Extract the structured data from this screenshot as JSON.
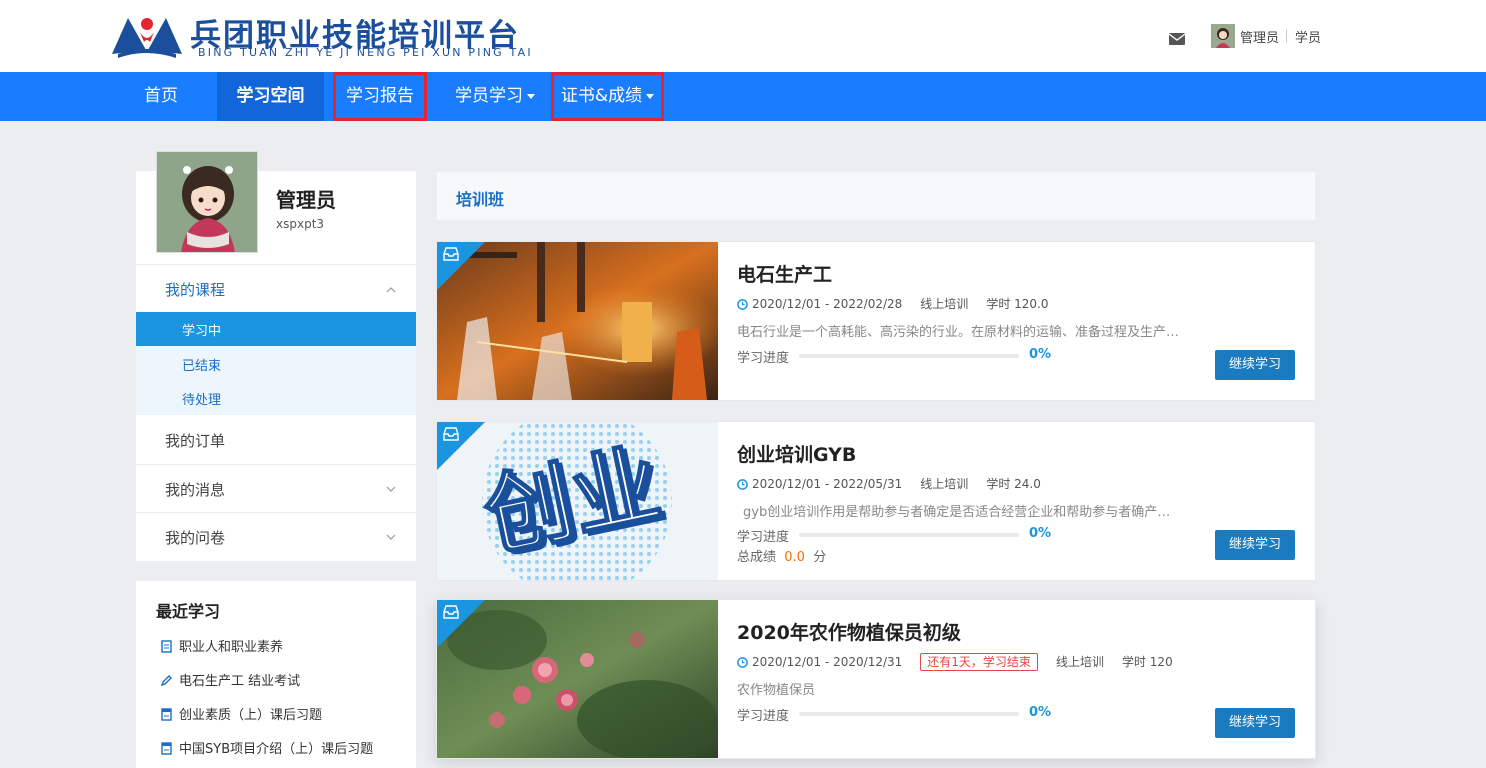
{
  "brand": {
    "title": "兵团职业技能培训平台",
    "subtitle": "BING TUAN ZHI YE JI NENG PEI XUN PING TAI"
  },
  "header": {
    "user_name": "管理员",
    "user_role": "学员"
  },
  "nav": {
    "items": [
      {
        "label": "首页"
      },
      {
        "label": "学习空间"
      },
      {
        "label": "学习报告"
      },
      {
        "label": "学员学习"
      },
      {
        "label": "证书&成绩"
      }
    ]
  },
  "profile": {
    "name": "管理员",
    "id": "xspxpt3"
  },
  "sidebar": {
    "my_courses": "我的课程",
    "sub": [
      {
        "label": "学习中"
      },
      {
        "label": "已结束"
      },
      {
        "label": "待处理"
      }
    ],
    "my_orders": "我的订单",
    "my_messages": "我的消息",
    "my_surveys": "我的问卷"
  },
  "recent": {
    "title": "最近学习",
    "items": [
      {
        "label": "职业人和职业素养",
        "icon": "document-icon"
      },
      {
        "label": "电石生产工 结业考试",
        "icon": "pencil-icon"
      },
      {
        "label": "创业素质（上）课后习题",
        "icon": "exercise-icon"
      },
      {
        "label": "中国SYB项目介绍（上）课后习题",
        "icon": "exercise-icon"
      }
    ]
  },
  "section": {
    "title": "培训班"
  },
  "courses": [
    {
      "title": "电石生产工",
      "dates": "2020/12/01 - 2022/02/28",
      "mode": "线上培训",
      "hours_label": "学时",
      "hours": "120.0",
      "desc": "电石行业是一个高耗能、高污染的行业。在原材料的运输、准备过程及生产过程中都会产生大量的粉尘和废气",
      "progress_label": "学习进度",
      "progress_text": "0%",
      "progress": 0,
      "button": "继续学习"
    },
    {
      "title": "创业培训GYB",
      "dates": "2020/12/01 - 2022/05/31",
      "mode": "线上培训",
      "hours_label": "学时",
      "hours": "24.0",
      "desc": "gyb创业培训作用是帮助参与者确定是否适合经营企业和帮助参与者确产生一个好的企业构思",
      "progress_label": "学习进度",
      "progress_text": "0%",
      "progress": 0,
      "score_label": "总成绩",
      "score": "0.0",
      "score_unit": "分",
      "thumb_text": "创业",
      "button": "继续学习"
    },
    {
      "title": "2020年农作物植保员初级",
      "dates": "2020/12/01 - 2020/12/31",
      "badge": "还有1天，学习结束",
      "mode": "线上培训",
      "hours_label": "学时",
      "hours": "120",
      "desc": "农作物植保员",
      "progress_label": "学习进度",
      "progress_text": "0%",
      "progress": 0,
      "button": "继续学习"
    }
  ],
  "colors": {
    "nav_bg": "#1a7cff",
    "accent": "#1b95e0",
    "button": "#1b7bc0",
    "highlight_box": "#e3262d"
  }
}
